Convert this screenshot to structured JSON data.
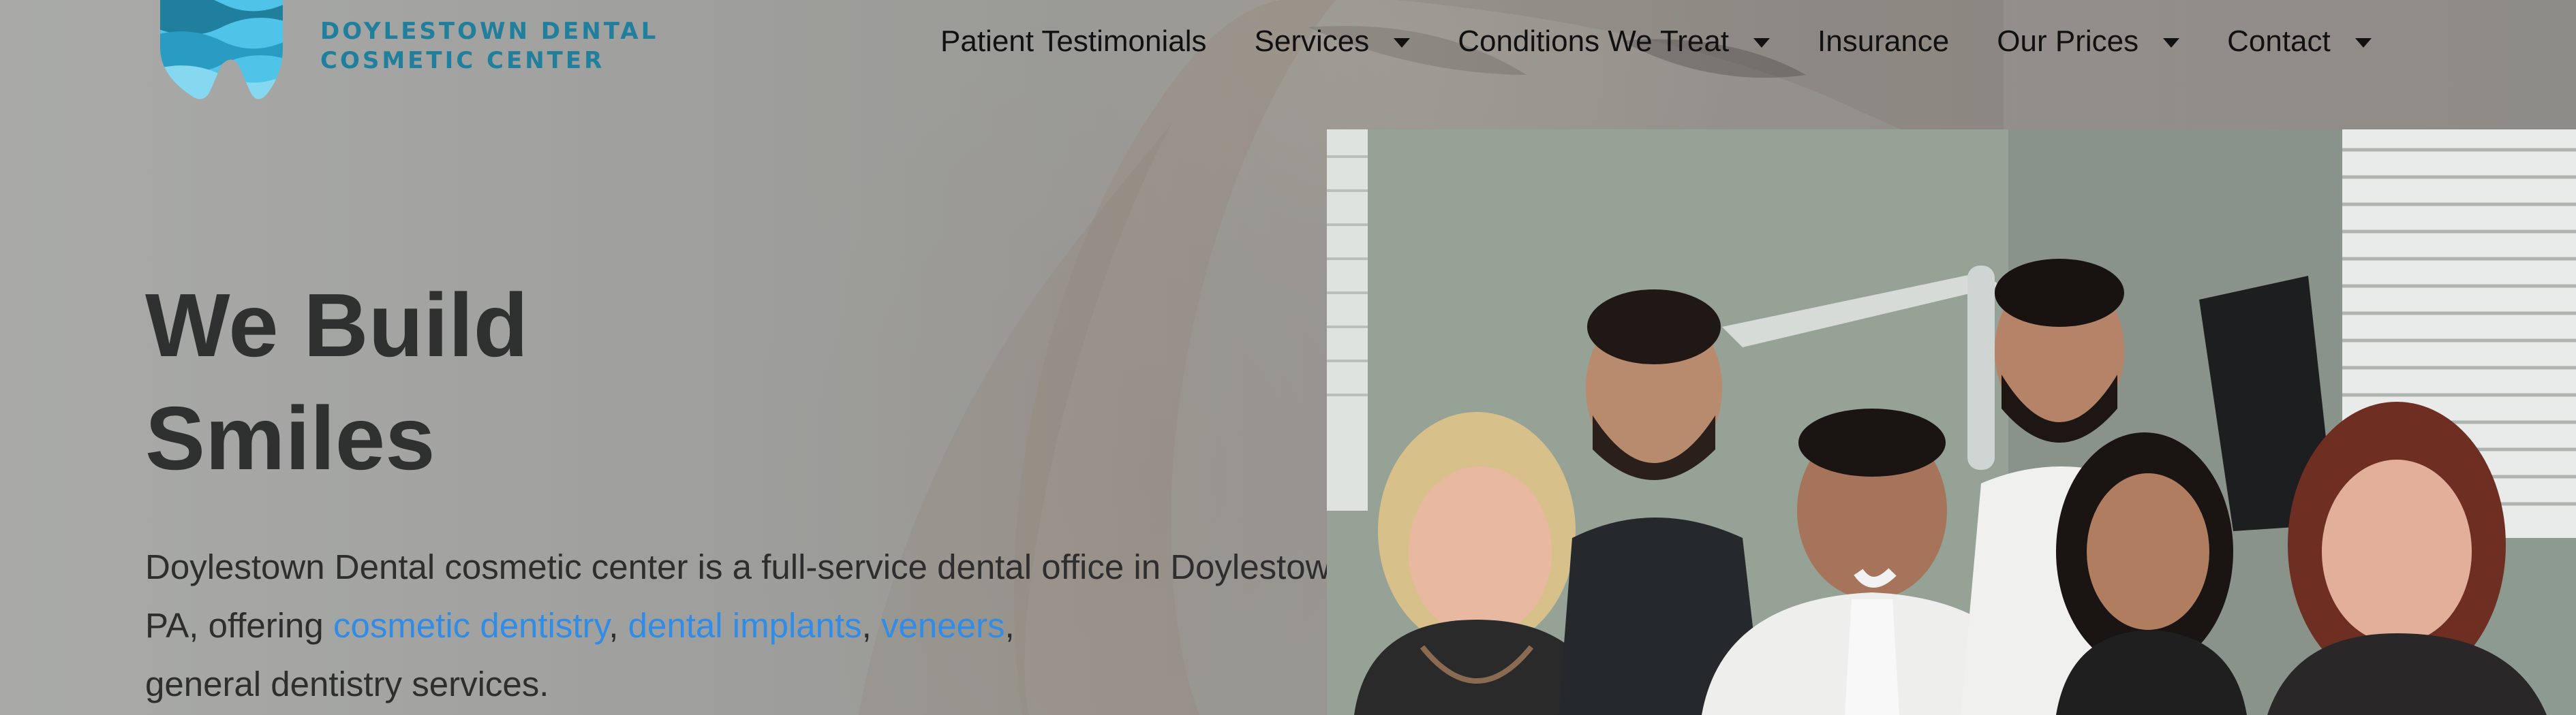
{
  "brand": {
    "name_line1": "DOYLESTOWN DENTAL",
    "name_line2": "COSMETIC CENTER",
    "logo_icon": "tooth-waves-logo",
    "colors": {
      "logo_teal": "#1f7f9c",
      "logo_light": "#4fc3e8",
      "link_blue": "#2f8ce8"
    }
  },
  "nav": {
    "items": [
      {
        "label": "Patient Testimonials",
        "has_dropdown": false
      },
      {
        "label": "Services",
        "has_dropdown": true
      },
      {
        "label": "Conditions We Treat",
        "has_dropdown": true
      },
      {
        "label": "Insurance",
        "has_dropdown": false
      },
      {
        "label": "Our Prices",
        "has_dropdown": true
      },
      {
        "label": "Contact",
        "has_dropdown": true
      }
    ],
    "dropdown_icon": "caret-down-icon"
  },
  "hero": {
    "title_line1": "We Build",
    "title_line2": "Smiles",
    "desc_part1": "Doylestown Dental cosmetic center is a full-service dental office in Doylestown, PA, offering ",
    "link1": "cosmetic dentistry",
    "sep1": ", ",
    "link2": "dental implants",
    "sep2": ", ",
    "link3": "veneers",
    "sep3": ",",
    "desc_part2": " general dentistry services."
  },
  "team_photo": {
    "icon": "team-photo-image"
  }
}
